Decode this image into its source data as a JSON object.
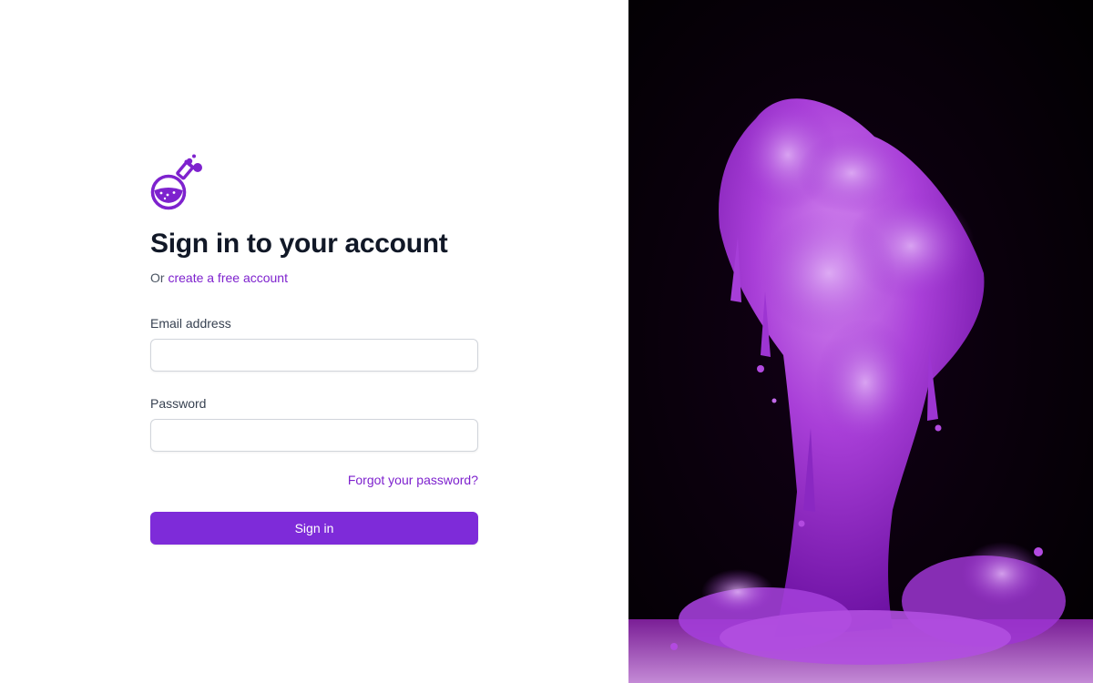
{
  "brand": {
    "logo_icon": "flask-icon",
    "accent_color": "#7e22ce"
  },
  "signin": {
    "title": "Sign in to your account",
    "subtitle_prefix": "Or",
    "create_account_link": "create a free account",
    "email_label": "Email address",
    "email_value": "",
    "password_label": "Password",
    "password_value": "",
    "forgot_link": "Forgot your password?",
    "submit_label": "Sign in",
    "button_color": "#7e2bd9"
  },
  "hero": {
    "image_description_icon": "purple-ink-splash-image"
  }
}
